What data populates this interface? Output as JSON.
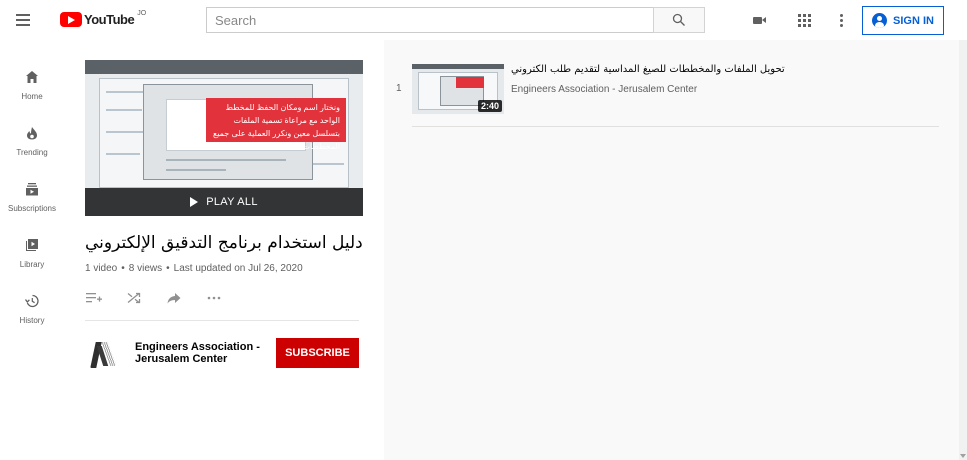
{
  "header": {
    "logo_text": "YouTube",
    "country_code": "JO",
    "search_placeholder": "Search",
    "signin_label": "SIGN IN",
    "icons": [
      "menu-icon",
      "search-icon",
      "video-camera-icon",
      "apps-grid-icon",
      "more-vert-icon",
      "account-icon"
    ]
  },
  "sidebar": {
    "items": [
      {
        "label": "Home",
        "icon": "home-icon"
      },
      {
        "label": "Trending",
        "icon": "fire-icon"
      },
      {
        "label": "Subscriptions",
        "icon": "subscriptions-icon"
      },
      {
        "label": "Library",
        "icon": "library-icon"
      },
      {
        "label": "History",
        "icon": "history-icon"
      }
    ]
  },
  "playlist": {
    "thumb_banner": "ونختار اسم ومكان الحفظ للمخطط الواحد مع مراعاة تسمية الملفات بتسلسل معين ونكرر العملية على جميع المخططات",
    "play_all_label": "PLAY ALL",
    "title": "دليل استخدام برنامج التدقيق الإلكتروني",
    "video_count": "1 video",
    "views": "8 views",
    "updated": "Last updated on Jul 26, 2020",
    "separator": "•",
    "actions": [
      "add-to-queue-icon",
      "shuffle-icon",
      "share-icon",
      "more-horiz-icon"
    ],
    "owner": {
      "name": "Engineers Association - Jerusalem Center",
      "subscribe_label": "SUBSCRIBE"
    }
  },
  "videos": [
    {
      "index": "1",
      "title": "تحويل الملفات والمخططات للصيغ المداسية لتقديم طلب الكتروني",
      "channel": "Engineers Association - Jerusalem Center",
      "duration": "2:40"
    }
  ],
  "colors": {
    "brand_red": "#ff0000",
    "subscribe_red": "#cc0000",
    "link_blue": "#065fd4",
    "page_bg": "#f9f9f9"
  }
}
